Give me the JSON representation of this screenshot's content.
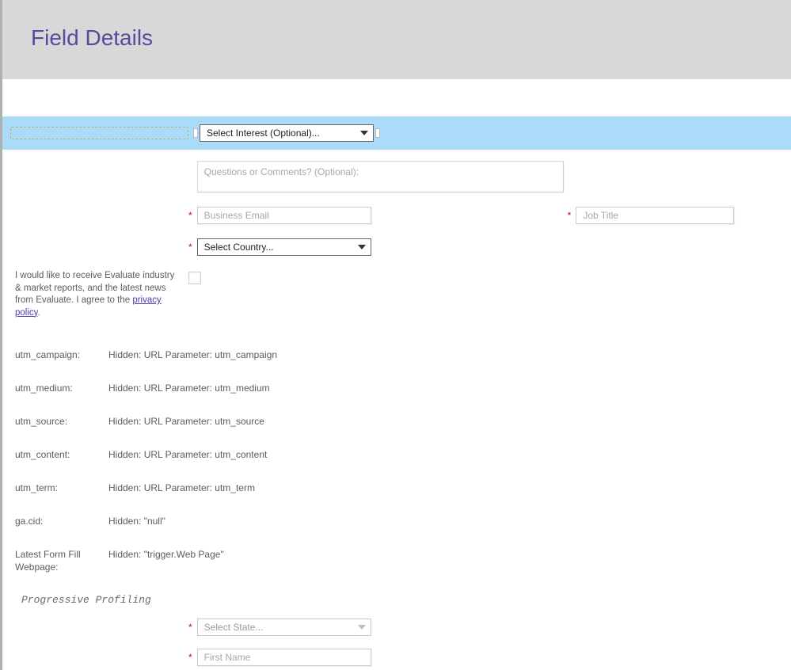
{
  "header": {
    "title": "Field Details"
  },
  "selectedRow": {
    "placeholder": "Select Interest (Optional)..."
  },
  "comments": {
    "placeholder": "Questions or Comments? (Optional):"
  },
  "email": {
    "placeholder": "Business Email"
  },
  "jobTitle": {
    "placeholder": "Job Title"
  },
  "country": {
    "placeholder": "Select Country..."
  },
  "consent": {
    "text_a": "I would like to receive Evaluate industry & market reports, and the latest news from Evaluate. I agree to the ",
    "text_link": "privacy policy",
    "text_b": "."
  },
  "hidden": [
    {
      "label": "utm_campaign:",
      "value": "Hidden: URL Parameter: utm_campaign"
    },
    {
      "label": "utm_medium:",
      "value": "Hidden: URL Parameter: utm_medium"
    },
    {
      "label": "utm_source:",
      "value": "Hidden: URL Parameter: utm_source"
    },
    {
      "label": "utm_content:",
      "value": "Hidden: URL Parameter: utm_content"
    },
    {
      "label": "utm_term:",
      "value": "Hidden: URL Parameter: utm_term"
    },
    {
      "label": "ga.cid:",
      "value": "Hidden: \"null\""
    },
    {
      "label": "Latest Form Fill Webpage:",
      "value": "Hidden: \"trigger.Web Page\""
    }
  ],
  "progressive": {
    "heading": "Progressive Profiling"
  },
  "state": {
    "placeholder": "Select State..."
  },
  "firstName": {
    "placeholder": "First Name"
  },
  "asterisk": "*"
}
